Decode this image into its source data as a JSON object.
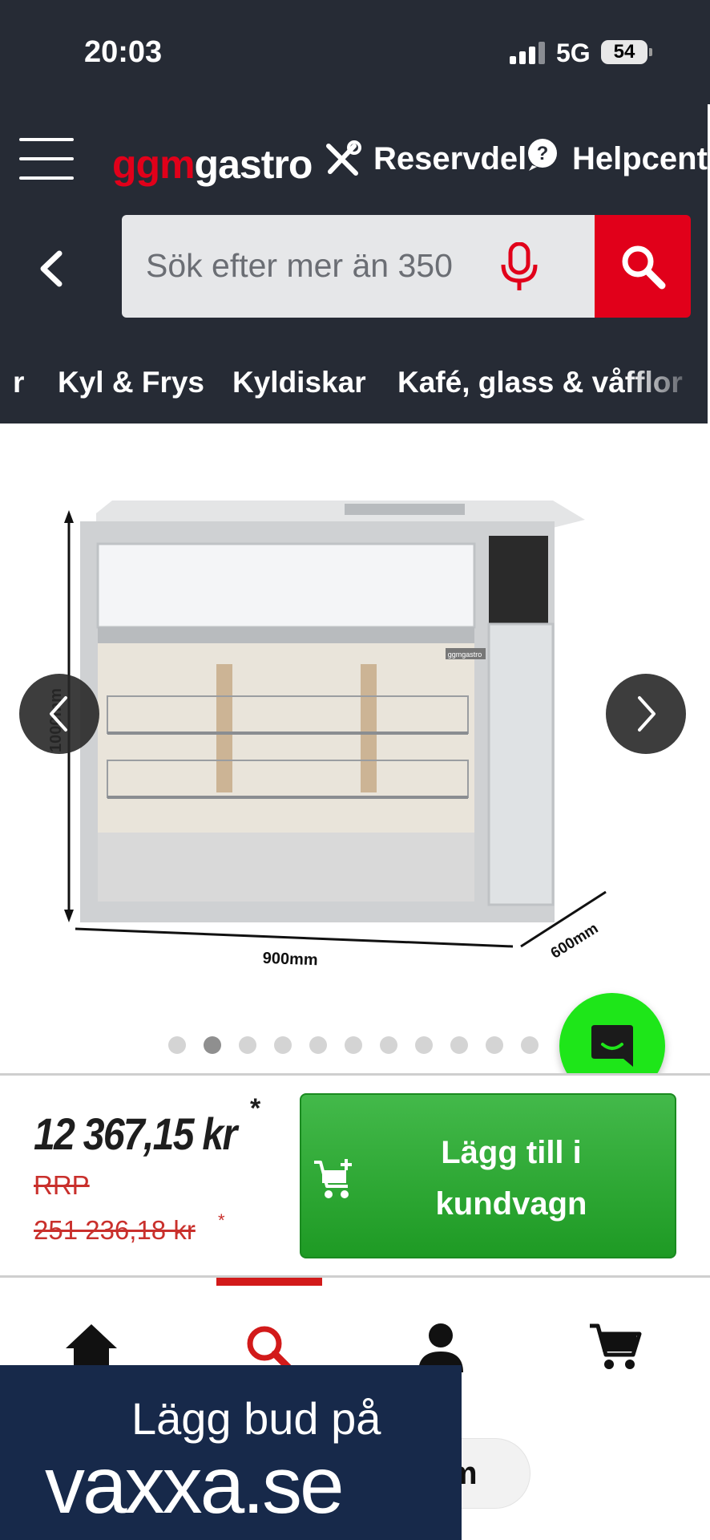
{
  "status_bar": {
    "time": "20:03",
    "network": "5G",
    "battery": "54"
  },
  "header": {
    "logo_ggm": "ggm",
    "logo_gastro": "gastro",
    "nav_links": [
      "Reservdelar",
      "Helpcenter"
    ],
    "search_placeholder": "Sök efter mer än 350",
    "categories": [
      "r",
      "Kyl & Frys",
      "Kyldiskar",
      "Kafé, glass & våfflor"
    ]
  },
  "product_image": {
    "dimension_height": "1000mm",
    "dimension_width": "900mm",
    "dimension_depth": "600mm",
    "badge_text": "ggmgastro"
  },
  "gallery": {
    "dot_count": 11,
    "active_dot": 1
  },
  "price": {
    "current": "12 367,15 kr",
    "current_asterisk": "*",
    "rrp_label": "RRP",
    "rrp_value": "251 236,18 kr",
    "rrp_asterisk": "*"
  },
  "cta": {
    "add_to_cart_label": "Lägg till i kundvagn"
  },
  "bottom_nav": {
    "pill_text": "m"
  },
  "ad": {
    "line1": "Lägg bud på",
    "line2": "vaxxa.se"
  },
  "colors": {
    "header_bg": "#262b35",
    "brand_red": "#e1001a",
    "cta_green": "#2ea834",
    "chat_green": "#1ee619",
    "ad_bg": "#17294a",
    "rrp_red": "#c9302c"
  },
  "icons": [
    "menu-icon",
    "tools-icon",
    "help-icon",
    "back-arrow-icon",
    "microphone-icon",
    "search-icon",
    "chevron-left-icon",
    "chevron-right-icon",
    "chat-icon",
    "cart-add-icon",
    "home-icon",
    "search-nav-icon",
    "user-icon",
    "cart-icon"
  ]
}
